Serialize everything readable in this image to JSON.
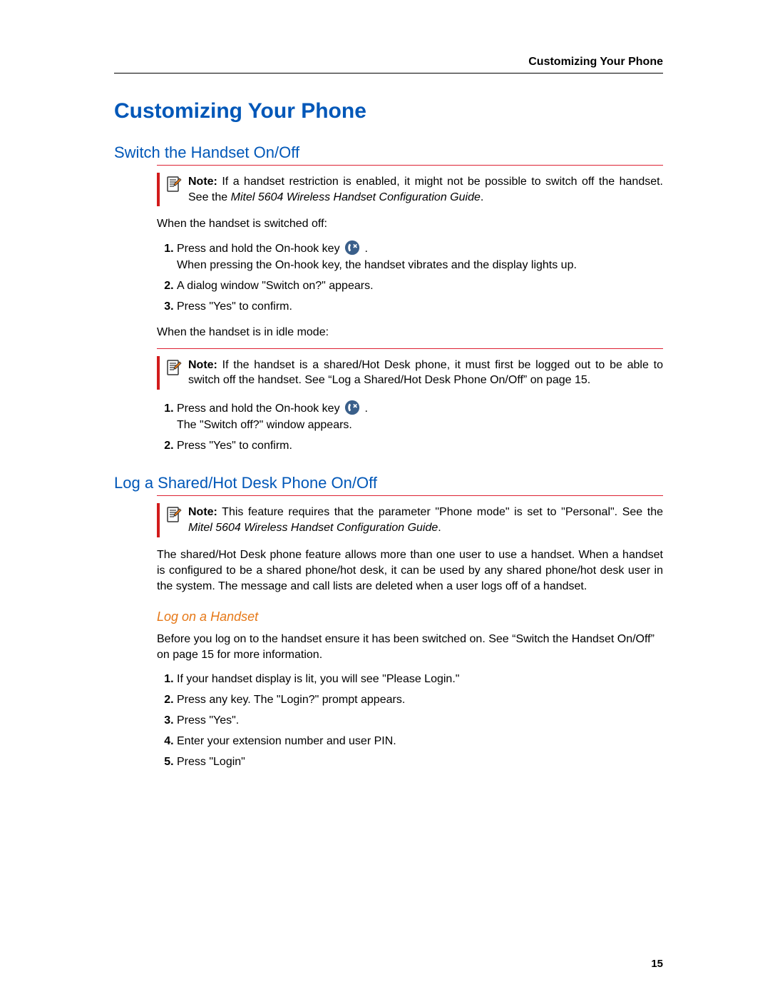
{
  "runningHead": "Customizing Your Phone",
  "pageTitle": "Customizing Your Phone",
  "pageNumber": "15",
  "section1": {
    "title": "Switch the Handset On/Off",
    "note1": {
      "lead": "Note:",
      "body": " If a handset restriction is enabled, it might not be possible to switch off the handset. See the ",
      "ref": "Mitel 5604 Wireless Handset Configuration Guide",
      "tail": "."
    },
    "intro1": "When the handset is switched off:",
    "steps1": [
      {
        "pre": "Press and hold the On-hook key ",
        "post": ".",
        "sub": "When pressing the On-hook key, the handset vibrates and the display lights up."
      },
      {
        "pre": "A dialog window \"Switch on?\" appears."
      },
      {
        "pre": "Press \"Yes\" to confirm."
      }
    ],
    "intro2": "When the handset is in idle mode:",
    "note2": {
      "lead": "Note:",
      "body": " If the handset is a shared/Hot Desk phone, it must first be logged out to be able to switch off the handset. See “Log a Shared/Hot Desk Phone On/Off” on page 15."
    },
    "steps2": [
      {
        "pre": "Press and hold the On-hook key ",
        "post": ".",
        "sub": "The \"Switch off?\" window appears."
      },
      {
        "pre": "Press \"Yes\" to confirm."
      }
    ]
  },
  "section2": {
    "title": "Log a Shared/Hot Desk Phone On/Off",
    "note": {
      "lead": "Note:",
      "body": " This feature requires that the parameter \"Phone mode\" is set to \"Personal\". See the ",
      "ref": "Mitel 5604 Wireless Handset Configuration Guide",
      "tail": "."
    },
    "para": "The shared/Hot Desk phone feature allows more than one user to use a handset. When a handset is configured to be a shared phone/hot desk, it can be used by any shared phone/hot desk user in the system. The message and call lists are deleted when a user logs off of a handset.",
    "subhead": "Log on a Handset",
    "para2": "Before you log on to the handset ensure it has been switched on. See “Switch the Handset On/Off” on page 15 for more information.",
    "steps": [
      "If your handset display is lit, you will see \"Please Login.\"",
      "Press any key. The \"Login?\" prompt appears.",
      "Press \"Yes\".",
      "Enter your extension number and user PIN.",
      "Press \"Login\""
    ]
  }
}
